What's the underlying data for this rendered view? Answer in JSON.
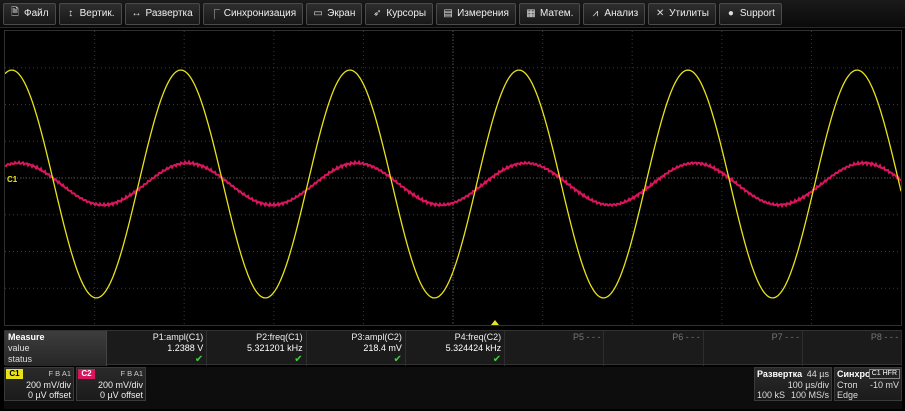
{
  "menu": [
    {
      "icon": "file-icon",
      "glyph": "🗎",
      "label": "Файл"
    },
    {
      "icon": "vertical-arrows-icon",
      "glyph": "↕",
      "label": "Вертик."
    },
    {
      "icon": "horizontal-arrows-icon",
      "glyph": "↔",
      "label": "Развертка"
    },
    {
      "icon": "trigger-edge-icon",
      "glyph": "⎾",
      "label": "Синхронизация"
    },
    {
      "icon": "display-icon",
      "glyph": "▭",
      "label": "Экран"
    },
    {
      "icon": "cursor-icon",
      "glyph": "➶",
      "label": "Курсоры"
    },
    {
      "icon": "measure-icon",
      "glyph": "▤",
      "label": "Измерения"
    },
    {
      "icon": "math-icon",
      "glyph": "▦",
      "label": "Матем."
    },
    {
      "icon": "analysis-icon",
      "glyph": "⩘",
      "label": "Анализ"
    },
    {
      "icon": "utilities-icon",
      "glyph": "✕",
      "label": "Утилиты"
    },
    {
      "icon": "info-icon",
      "glyph": "●",
      "label": "Support"
    }
  ],
  "display": {
    "ch1_marker": "C1",
    "colors": {
      "c1": "#e8e21a",
      "c2": "#d8165c",
      "grid": "#3a3a3a",
      "background": "#000000"
    },
    "traces": {
      "c1": {
        "cycles_on_screen": 5.3,
        "amplitude_divs": 3.1,
        "phase_frac": 0.04
      },
      "c2": {
        "cycles_on_screen": 5.3,
        "amplitude_divs": 0.57,
        "phase_frac": 0.08
      }
    }
  },
  "measure": {
    "title": "Measure",
    "row_value": "value",
    "row_status": "status",
    "params": [
      {
        "name": "P1:ampl(C1)",
        "value": "1.2388 V",
        "ok": "✔",
        "active": true
      },
      {
        "name": "P2:freq(C1)",
        "value": "5.321201 kHz",
        "ok": "✔",
        "active": true
      },
      {
        "name": "P3:ampl(C2)",
        "value": "218.4 mV",
        "ok": "✔",
        "active": true
      },
      {
        "name": "P4:freq(C2)",
        "value": "5.324424 kHz",
        "ok": "✔",
        "active": true
      },
      {
        "name": "P5 - - -",
        "value": "",
        "ok": "",
        "active": false
      },
      {
        "name": "P6 - - -",
        "value": "",
        "ok": "",
        "active": false
      },
      {
        "name": "P7 - - -",
        "value": "",
        "ok": "",
        "active": false
      },
      {
        "name": "P8 - - -",
        "value": "",
        "ok": "",
        "active": false
      }
    ]
  },
  "channels": [
    {
      "tag": "C1",
      "flags": "F B A1",
      "vdiv": "200 mV/div",
      "offset": "0 µV offset",
      "color": "#e8e21a"
    },
    {
      "tag": "C2",
      "flags": "F B A1",
      "vdiv": "200 mV/div",
      "offset": "0 µV offset",
      "color": "#d8165c"
    }
  ],
  "timebase": {
    "title": "Развертка",
    "delay": "44 µs",
    "tdiv": "100 µs/div",
    "samples": "100 kS",
    "rate": "100 MS/s"
  },
  "trigger": {
    "title": "Синхро",
    "source": "C1 HFR",
    "mode": "Стоп",
    "level": "-10 mV",
    "type": "Edge"
  }
}
